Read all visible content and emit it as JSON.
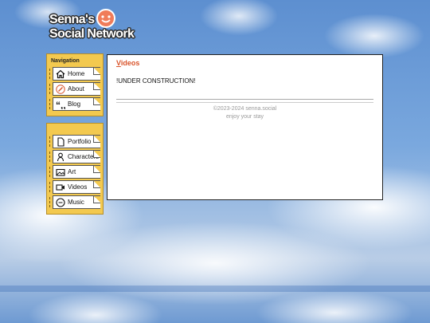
{
  "logo": {
    "line1": "Senna's",
    "line2": "Social Network"
  },
  "nav": {
    "heading": "Navigation",
    "items": [
      {
        "label": "Home",
        "icon": "home-icon"
      },
      {
        "label": "About",
        "icon": "pencil-icon"
      },
      {
        "label": "Blog",
        "icon": "quote-icon"
      }
    ]
  },
  "nav2": {
    "heading": "",
    "items": [
      {
        "label": "Portfolio",
        "icon": "document-icon"
      },
      {
        "label": "Characters",
        "icon": "person-icon"
      },
      {
        "label": "Art",
        "icon": "image-icon"
      },
      {
        "label": "Videos",
        "icon": "video-camera-icon"
      },
      {
        "label": "Music",
        "icon": "music-icon"
      }
    ]
  },
  "page": {
    "title_first": "V",
    "title_rest": "ideos",
    "body": "!UNDER CONSTRUCTION!"
  },
  "footer": {
    "copyright": "©2023-2024 senna.social",
    "tagline": "enjoy your stay"
  },
  "colors": {
    "accent": "#d9542b",
    "panel": "#f3c94f"
  }
}
